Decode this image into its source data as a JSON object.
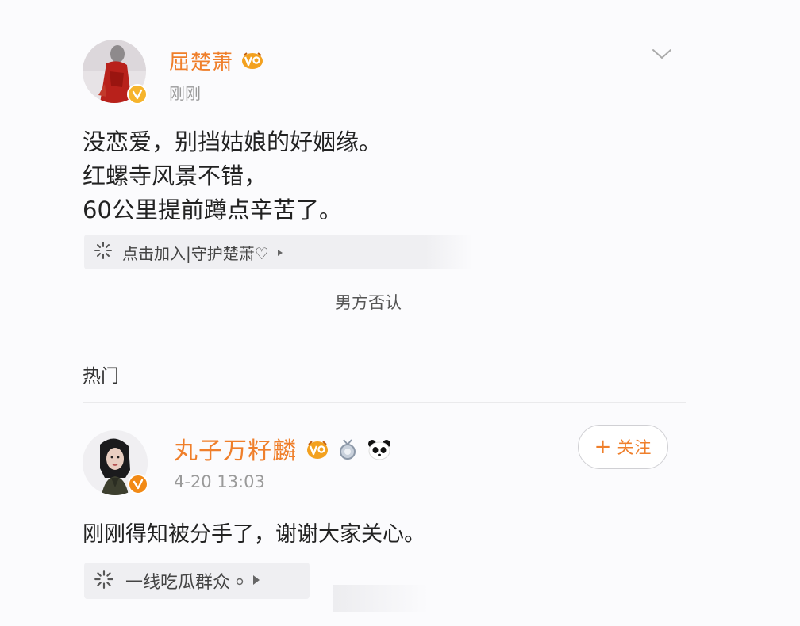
{
  "post1": {
    "username": "屈楚萧",
    "time": "刚刚",
    "lines": [
      "没恋爱，别挡姑娘的好姻缘。",
      "红螺寺风景不错，",
      "60公里提前蹲点辛苦了。"
    ],
    "topic_chip": "点击加入|守护楚萧♡"
  },
  "caption": "男方否认",
  "section_label": "热门",
  "post2": {
    "username": "丸子万籽麟",
    "time": "4-20 13:03",
    "text": "刚刚得知被分手了，谢谢大家关心。",
    "follow_label": "关注",
    "topic_chip": "一线吃瓜群众"
  },
  "colors": {
    "username": "#ef7f2b",
    "verified_badge_1": "#f6b42c",
    "verified_badge_2": "#f28a16",
    "background": "#fbfbfd"
  },
  "icons": [
    "chevron-down-icon",
    "vip-badge-icon",
    "verified-badge-icon",
    "sparkle-icon",
    "play-triangle-icon",
    "medal-icon",
    "panda-icon",
    "plus-icon"
  ]
}
